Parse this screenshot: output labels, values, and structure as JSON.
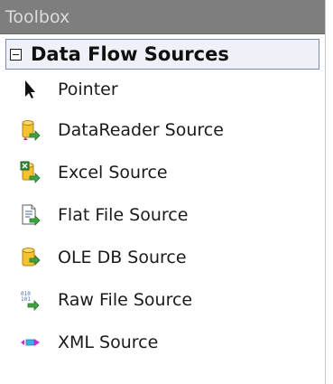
{
  "toolbox": {
    "title": "Toolbox",
    "group": {
      "label": "Data Flow Sources",
      "expanded": true
    },
    "items": [
      {
        "label": "Pointer",
        "icon": "pointer-arrow-icon"
      },
      {
        "label": "DataReader Source",
        "icon": "datareader-source-icon"
      },
      {
        "label": "Excel Source",
        "icon": "excel-source-icon"
      },
      {
        "label": "Flat File Source",
        "icon": "flat-file-source-icon"
      },
      {
        "label": "OLE DB Source",
        "icon": "oledb-source-icon"
      },
      {
        "label": "Raw File Source",
        "icon": "raw-file-source-icon"
      },
      {
        "label": "XML Source",
        "icon": "xml-source-icon"
      }
    ]
  },
  "colors": {
    "header_bg": "#7e7e7e",
    "header_text": "#dcdcdc",
    "group_bg": "#eef1f8",
    "group_border": "#7b8bb5",
    "arrow_green": "#3fa33f",
    "db_yellow": "#f2c230"
  }
}
